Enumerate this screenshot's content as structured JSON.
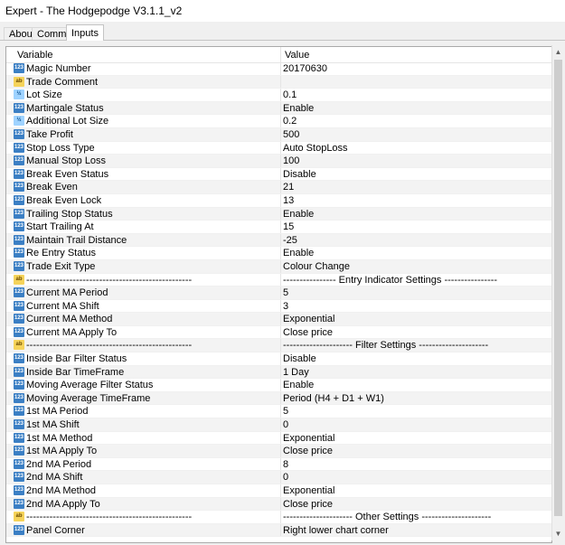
{
  "window": {
    "title": "Expert - The Hodgepodge V3.1.1_v2"
  },
  "tabs": [
    {
      "label": "About"
    },
    {
      "label": "Common"
    },
    {
      "label": "Inputs"
    }
  ],
  "grid": {
    "headers": {
      "variable": "Variable",
      "value": "Value"
    },
    "rows": [
      {
        "icon": "123",
        "name": "Magic Number",
        "value": "20170630"
      },
      {
        "icon": "ab",
        "name": "Trade Comment",
        "value": ""
      },
      {
        "icon": "v2",
        "name": "Lot Size",
        "value": "0.1"
      },
      {
        "icon": "123",
        "name": "Martingale Status",
        "value": "Enable"
      },
      {
        "icon": "v2",
        "name": "Additional Lot Size",
        "value": "0.2"
      },
      {
        "icon": "123",
        "name": "Take Profit",
        "value": "500"
      },
      {
        "icon": "123",
        "name": "Stop Loss Type",
        "value": "Auto StopLoss"
      },
      {
        "icon": "123",
        "name": "Manual Stop Loss",
        "value": "100"
      },
      {
        "icon": "123",
        "name": "Break Even Status",
        "value": "Disable"
      },
      {
        "icon": "123",
        "name": "Break Even",
        "value": "21"
      },
      {
        "icon": "123",
        "name": "Break Even Lock",
        "value": "13"
      },
      {
        "icon": "123",
        "name": "Trailing Stop Status",
        "value": "Enable"
      },
      {
        "icon": "123",
        "name": "Start Trailing At",
        "value": "15"
      },
      {
        "icon": "123",
        "name": "Maintain Trail Distance",
        "value": "-25"
      },
      {
        "icon": "123",
        "name": "Re Entry Status",
        "value": "Enable"
      },
      {
        "icon": "123",
        "name": "Trade Exit Type",
        "value": "Colour Change"
      },
      {
        "icon": "ab",
        "name": "--------------------------------------------------",
        "value": "---------------- Entry Indicator Settings ----------------"
      },
      {
        "icon": "123",
        "name": "Current MA Period",
        "value": "5"
      },
      {
        "icon": "123",
        "name": "Current MA Shift",
        "value": "3"
      },
      {
        "icon": "123",
        "name": "Current MA Method",
        "value": "Exponential"
      },
      {
        "icon": "123",
        "name": "Current MA Apply To",
        "value": "Close price"
      },
      {
        "icon": "ab",
        "name": "--------------------------------------------------",
        "value": "--------------------- Filter Settings ---------------------"
      },
      {
        "icon": "123",
        "name": "Inside Bar Filter Status",
        "value": "Disable"
      },
      {
        "icon": "123",
        "name": "Inside Bar TimeFrame",
        "value": "1 Day"
      },
      {
        "icon": "123",
        "name": "Moving Average Filter Status",
        "value": "Enable"
      },
      {
        "icon": "123",
        "name": "Moving Average TimeFrame",
        "value": "Period (H4 + D1 + W1)"
      },
      {
        "icon": "123",
        "name": "1st MA Period",
        "value": "5"
      },
      {
        "icon": "123",
        "name": "1st MA Shift",
        "value": "0"
      },
      {
        "icon": "123",
        "name": "1st MA Method",
        "value": "Exponential"
      },
      {
        "icon": "123",
        "name": "1st MA Apply To",
        "value": "Close price"
      },
      {
        "icon": "123",
        "name": "2nd MA Period",
        "value": "8"
      },
      {
        "icon": "123",
        "name": "2nd MA Shift",
        "value": "0"
      },
      {
        "icon": "123",
        "name": "2nd MA Method",
        "value": "Exponential"
      },
      {
        "icon": "123",
        "name": "2nd MA Apply To",
        "value": "Close price"
      },
      {
        "icon": "ab",
        "name": "--------------------------------------------------",
        "value": "--------------------- Other Settings ---------------------"
      },
      {
        "icon": "123",
        "name": "Panel Corner",
        "value": "Right lower chart corner"
      }
    ]
  },
  "icons": {
    "123": {
      "glyph": "123",
      "name": "integer-type-icon"
    },
    "v2": {
      "glyph": "½",
      "name": "double-type-icon"
    },
    "ab": {
      "glyph": "ab",
      "name": "string-type-icon"
    }
  },
  "scrollbar": {
    "up": "▲",
    "down": "▼"
  }
}
